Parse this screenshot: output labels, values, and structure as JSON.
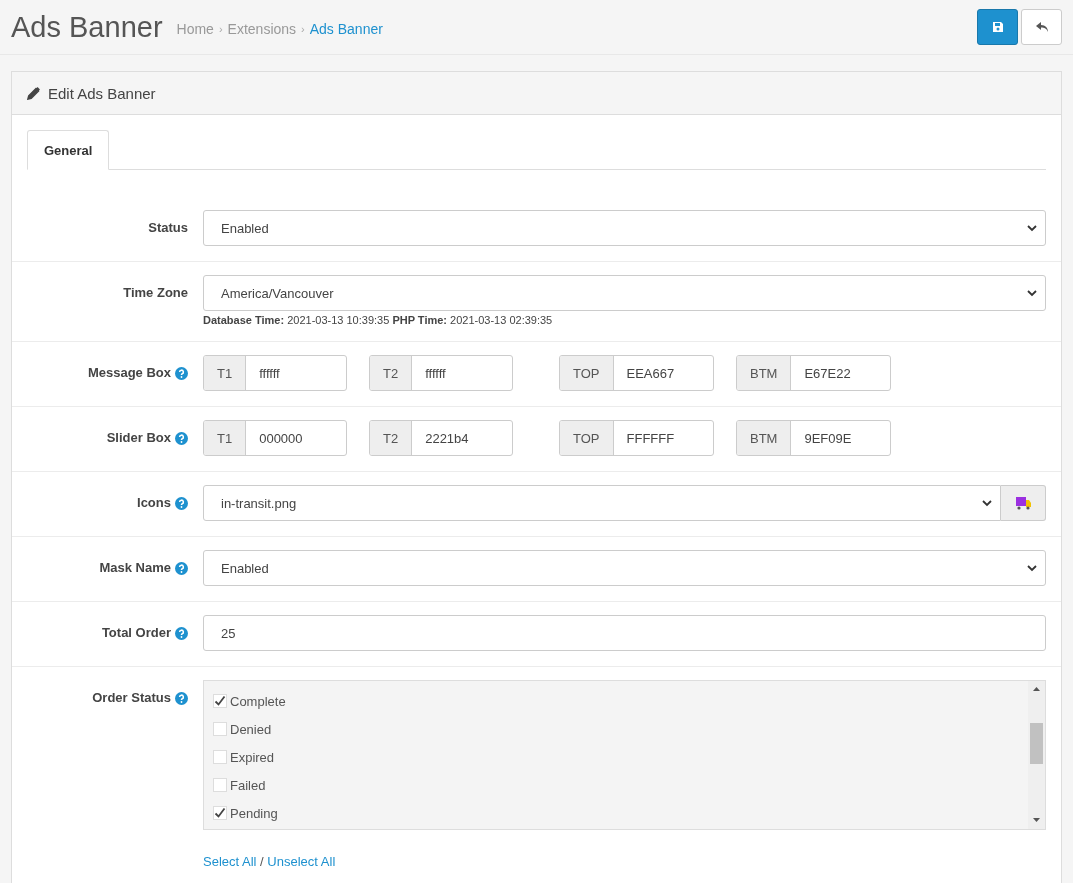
{
  "page_title": "Ads Banner",
  "breadcrumb_separator": "›",
  "breadcrumbs": [
    {
      "label": "Home",
      "current": false
    },
    {
      "label": "Extensions",
      "current": false
    },
    {
      "label": "Ads Banner",
      "current": true
    }
  ],
  "panel_title": "Edit Ads Banner",
  "tabs": [
    {
      "label": "General",
      "selected": true
    }
  ],
  "fields": [
    {
      "kind": "select",
      "label": "Status",
      "help": false,
      "value": "Enabled"
    },
    {
      "kind": "select",
      "label": "Time Zone",
      "help": false,
      "value": "America/Vancouver",
      "note": [
        {
          "label": "Database Time:",
          "value": "2021-03-13 10:39:35"
        },
        {
          "label": "PHP Time:",
          "value": "2021-03-13 02:39:35"
        }
      ]
    },
    {
      "kind": "colors",
      "label": "Message Box",
      "help": true,
      "groups": [
        {
          "addon": "T1",
          "value": "ffffff"
        },
        {
          "addon": "T2",
          "value": "ffffff"
        },
        {
          "addon": "TOP",
          "value": "EEA667"
        },
        {
          "addon": "BTM",
          "value": "E67E22"
        }
      ]
    },
    {
      "kind": "colors",
      "label": "Slider Box",
      "help": true,
      "groups": [
        {
          "addon": "T1",
          "value": "000000"
        },
        {
          "addon": "T2",
          "value": "2221b4"
        },
        {
          "addon": "TOP",
          "value": "FFFFFF"
        },
        {
          "addon": "BTM",
          "value": "9EF09E"
        }
      ]
    },
    {
      "kind": "icon_select",
      "label": "Icons",
      "help": true,
      "value": "in-transit.png"
    },
    {
      "kind": "select",
      "label": "Mask Name",
      "help": true,
      "value": "Enabled"
    },
    {
      "kind": "text",
      "label": "Total Order",
      "help": true,
      "value": "25"
    },
    {
      "kind": "checklist",
      "label": "Order Status",
      "help": true,
      "items": [
        {
          "label": "Complete",
          "checked": true
        },
        {
          "label": "Denied",
          "checked": false
        },
        {
          "label": "Expired",
          "checked": false
        },
        {
          "label": "Failed",
          "checked": false
        },
        {
          "label": "Pending",
          "checked": true
        }
      ],
      "links": [
        {
          "label": "Select All"
        },
        {
          "label": "Unselect All"
        }
      ],
      "link_separator": "/"
    }
  ]
}
